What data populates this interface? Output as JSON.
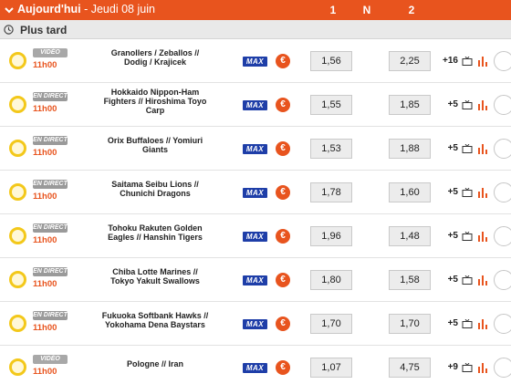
{
  "header": {
    "title_bold": "Aujourd'hui",
    "title_rest": " - Jeudi 08 juin",
    "col_1": "1",
    "col_n": "N",
    "col_2": "2"
  },
  "section": {
    "label": "Plus tard"
  },
  "icons": {
    "ticket_glyph": "€",
    "max_label": "MAX",
    "accent": "#e8541e",
    "ball_color": "#f3c81a",
    "max_color": "#1e3ea8"
  },
  "rows": [
    {
      "badge": "VIDÉO",
      "time": "11h00",
      "match_line1": "Granollers / Zeballos //",
      "match_line2": "Dodig / Krajicek",
      "match_line3": "",
      "odd1": "1,56",
      "odd2": "2,25",
      "more": "+16"
    },
    {
      "badge": "EN DIRECT",
      "time": "11h00",
      "match_line1": "Hokkaido Nippon-Ham",
      "match_line2": "Fighters // Hiroshima Toyo",
      "match_line3": "Carp",
      "odd1": "1,55",
      "odd2": "1,85",
      "more": "+5"
    },
    {
      "badge": "EN DIRECT",
      "time": "11h00",
      "match_line1": "Orix Buffaloes // Yomiuri",
      "match_line2": "Giants",
      "match_line3": "",
      "odd1": "1,53",
      "odd2": "1,88",
      "more": "+5"
    },
    {
      "badge": "EN DIRECT",
      "time": "11h00",
      "match_line1": "Saitama Seibu Lions //",
      "match_line2": "Chunichi Dragons",
      "match_line3": "",
      "odd1": "1,78",
      "odd2": "1,60",
      "more": "+5"
    },
    {
      "badge": "EN DIRECT",
      "time": "11h00",
      "match_line1": "Tohoku Rakuten Golden",
      "match_line2": "Eagles // Hanshin Tigers",
      "match_line3": "",
      "odd1": "1,96",
      "odd2": "1,48",
      "more": "+5"
    },
    {
      "badge": "EN DIRECT",
      "time": "11h00",
      "match_line1": "Chiba Lotte Marines //",
      "match_line2": "Tokyo Yakult Swallows",
      "match_line3": "",
      "odd1": "1,80",
      "odd2": "1,58",
      "more": "+5"
    },
    {
      "badge": "EN DIRECT",
      "time": "11h00",
      "match_line1": "Fukuoka Softbank Hawks //",
      "match_line2": "Yokohama Dena Baystars",
      "match_line3": "",
      "odd1": "1,70",
      "odd2": "1,70",
      "more": "+5"
    },
    {
      "badge": "VIDÉO",
      "time": "11h00",
      "match_line1": "Pologne // Iran",
      "match_line2": "",
      "match_line3": "",
      "odd1": "1,07",
      "odd2": "4,75",
      "more": "+9"
    }
  ]
}
